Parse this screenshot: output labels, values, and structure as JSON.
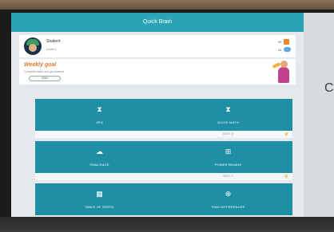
{
  "app": {
    "title": "Quick Brain"
  },
  "profile": {
    "name": "Student",
    "level": "Level 1",
    "stats": [
      {
        "value": "99",
        "icon": "gem-icon"
      },
      {
        "value": "44",
        "icon": "cloud-icon"
      }
    ]
  },
  "weekly_goal": {
    "title": "Weekly goal",
    "subtitle": "Complete tasks and get rewards",
    "button_label": "Start"
  },
  "tiles": [
    {
      "label": "ZEN",
      "icon": "⧗"
    },
    {
      "label": "QUICK MATH",
      "icon": "⧗"
    },
    {
      "label": "SNAILRACE",
      "icon": "☁"
    },
    {
      "label": "POWER BRAINS",
      "icon": "⊞"
    },
    {
      "label": "TABLE OF GREEK",
      "icon": "▦"
    },
    {
      "label": "FIND DIFFERENCES",
      "icon": "⊕"
    }
  ],
  "best_scores": [
    "BEST: 8",
    "BEST: 3"
  ],
  "side_panel": {
    "partial_letter": "C"
  },
  "colors": {
    "title_bar": "#2aa3b4",
    "tile": "#1f8fa6",
    "goal_title": "#e07a2a",
    "crown": "#e3b21d"
  }
}
